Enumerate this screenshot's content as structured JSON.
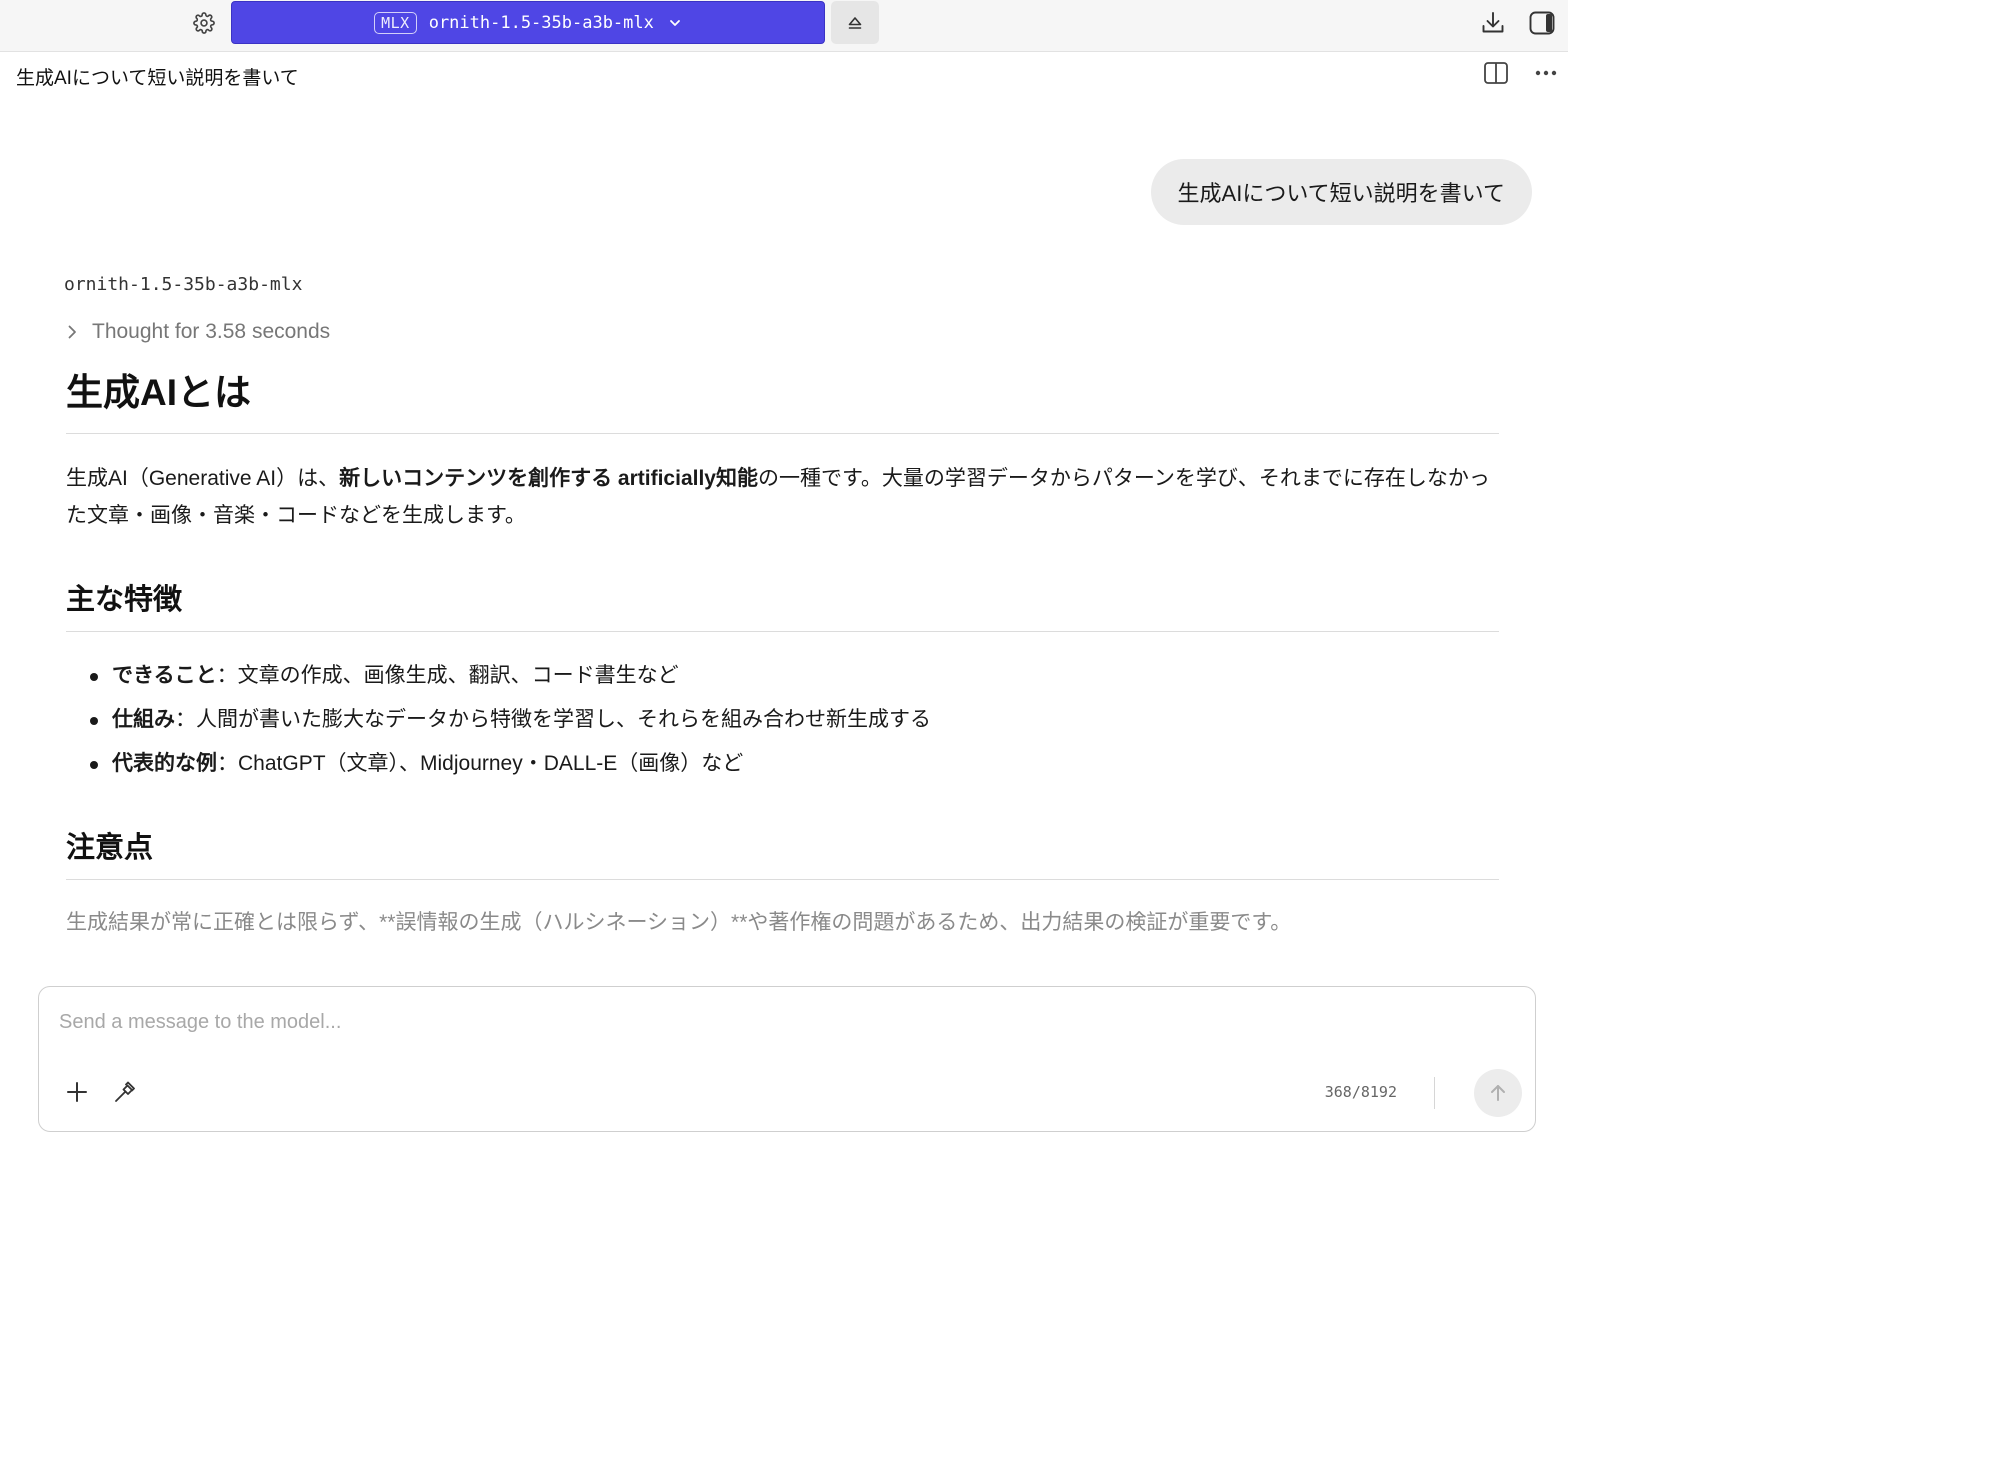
{
  "toolbar": {
    "model_badge": "MLX",
    "model_name": "ornith-1.5-35b-a3b-mlx",
    "accent_color": "#4f46e5",
    "icons": [
      "gear-icon",
      "chevron-down-icon",
      "eject-icon",
      "download-icon",
      "sidebar-toggle-icon"
    ]
  },
  "conversation": {
    "title": "生成AIについて短い説明を書いて",
    "header_icons": [
      "split-view-icon",
      "more-icon"
    ]
  },
  "user_message": {
    "text": "生成AIについて短い説明を書いて"
  },
  "assistant": {
    "model_name": "ornith-1.5-35b-a3b-mlx",
    "thought_label": "Thought for 3.58 seconds",
    "heading": "生成AIとは",
    "intro": {
      "part1": "生成AI（Generative AI）は、",
      "bold": "新しいコンテンツを創作する artificially知能",
      "part2": "の一種です。大量の学習データからパターンを学び、それまでに存在しなかった文章・画像・音楽・コードなどを生成します。"
    },
    "features_heading": "主な特徴",
    "features": [
      {
        "term": "できること",
        "desc": "：文章の作成、画像生成、翻訳、コード書生など"
      },
      {
        "term": "仕組み",
        "desc": "：人間が書いた膨大なデータから特徴を学習し、それらを組み合わせ新生成する"
      },
      {
        "term": "代表的な例",
        "desc": "：ChatGPT（文章）、Midjourney・DALL-E（画像）など"
      }
    ],
    "notes_heading": "注意点",
    "notes_text": "生成結果が常に正確とは限らず、**誤情報の生成（ハルシネーション）**や著作権の問題があるため、出力結果の検証が重要です。"
  },
  "composer": {
    "placeholder": "Send a message to the model...",
    "value": "",
    "token_count": "368/8192",
    "icons": [
      "plus-icon",
      "hammer-icon",
      "arrow-up-icon"
    ]
  }
}
